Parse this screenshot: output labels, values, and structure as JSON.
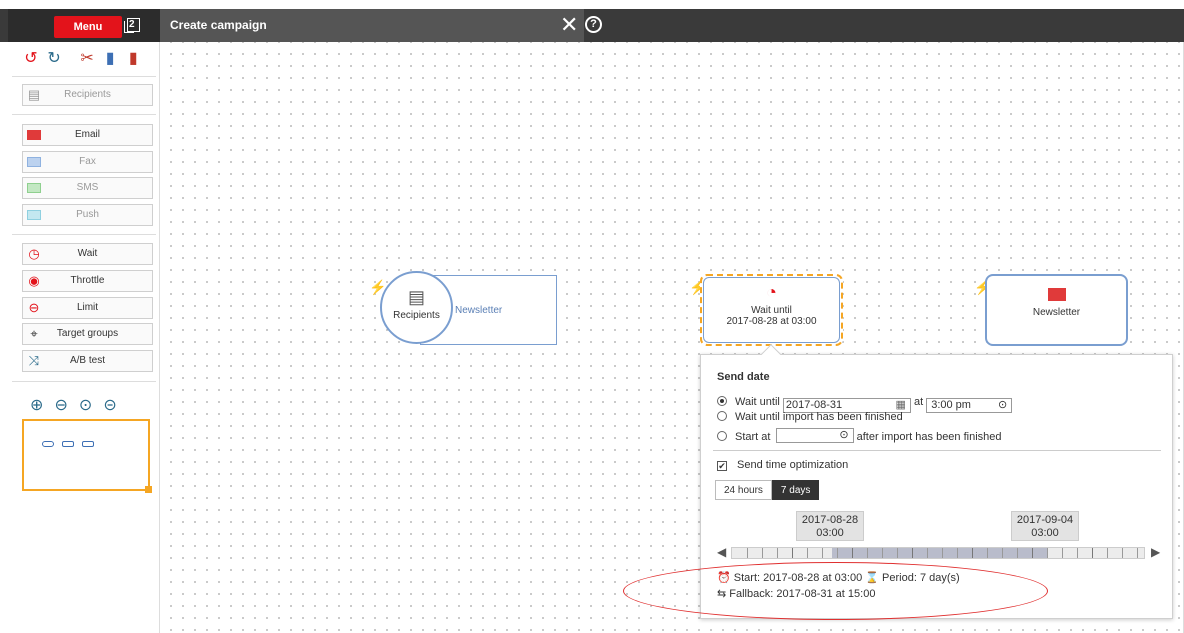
{
  "header": {
    "menu_label": "Menu",
    "window_count": "2",
    "title": "Create campaign",
    "close_glyph": "✕",
    "help_glyph": "?"
  },
  "sidebar": {
    "tool_icons": [
      "undo-icon",
      "redo-icon",
      "cut-icon",
      "copy-icon",
      "paste-icon"
    ],
    "recipients": "Recipients",
    "channels": [
      {
        "label": "Email",
        "icon": "email-icon",
        "enabled": true
      },
      {
        "label": "Fax",
        "icon": "fax-icon",
        "enabled": false
      },
      {
        "label": "SMS",
        "icon": "sms-icon",
        "enabled": false
      },
      {
        "label": "Push",
        "icon": "push-icon",
        "enabled": false
      }
    ],
    "logic": [
      {
        "label": "Wait",
        "icon": "clock-icon"
      },
      {
        "label": "Throttle",
        "icon": "throttle-icon"
      },
      {
        "label": "Limit",
        "icon": "limit-icon"
      },
      {
        "label": "Target groups",
        "icon": "crosshair-icon"
      },
      {
        "label": "A/B test",
        "icon": "shuffle-icon"
      }
    ],
    "zoom_icons": [
      "zoom-in-icon",
      "zoom-out-icon",
      "zoom-reset-icon",
      "zoom-fit-icon"
    ]
  },
  "canvas": {
    "recipients_node": {
      "label": "Recipients",
      "name": "Newsletter"
    },
    "wait_node": {
      "line1": "Wait until",
      "line2": "2017-08-28 at 03:00"
    },
    "newsletter_node": {
      "label": "Newsletter"
    }
  },
  "popup": {
    "heading": "Send date",
    "opt_wait_until": "Wait until",
    "wait_date": "2017-08-31",
    "at": "at",
    "wait_time": "3:00 pm",
    "opt_import": "Wait until import has been finished",
    "opt_start": "Start at",
    "start_value": "",
    "after_import": "after import has been finished",
    "sto_label": "Send time optimization",
    "sto_checked": true,
    "tab_24h": "24 hours",
    "tab_7d": "7 days",
    "marker_start_date": "2017-08-28",
    "marker_start_time": "03:00",
    "marker_end_date": "2017-09-04",
    "marker_end_time": "03:00",
    "start_info": "Start: 2017-08-28 at 03:00",
    "period_info": "Period: 7 day(s)",
    "fallback_info": "Fallback: 2017-08-31 at 15:00"
  },
  "colors": {
    "menu_red": "#e3131b",
    "selection_orange": "#f5a623",
    "node_blue": "#7a9ed0",
    "annotation_red": "#e03030"
  }
}
